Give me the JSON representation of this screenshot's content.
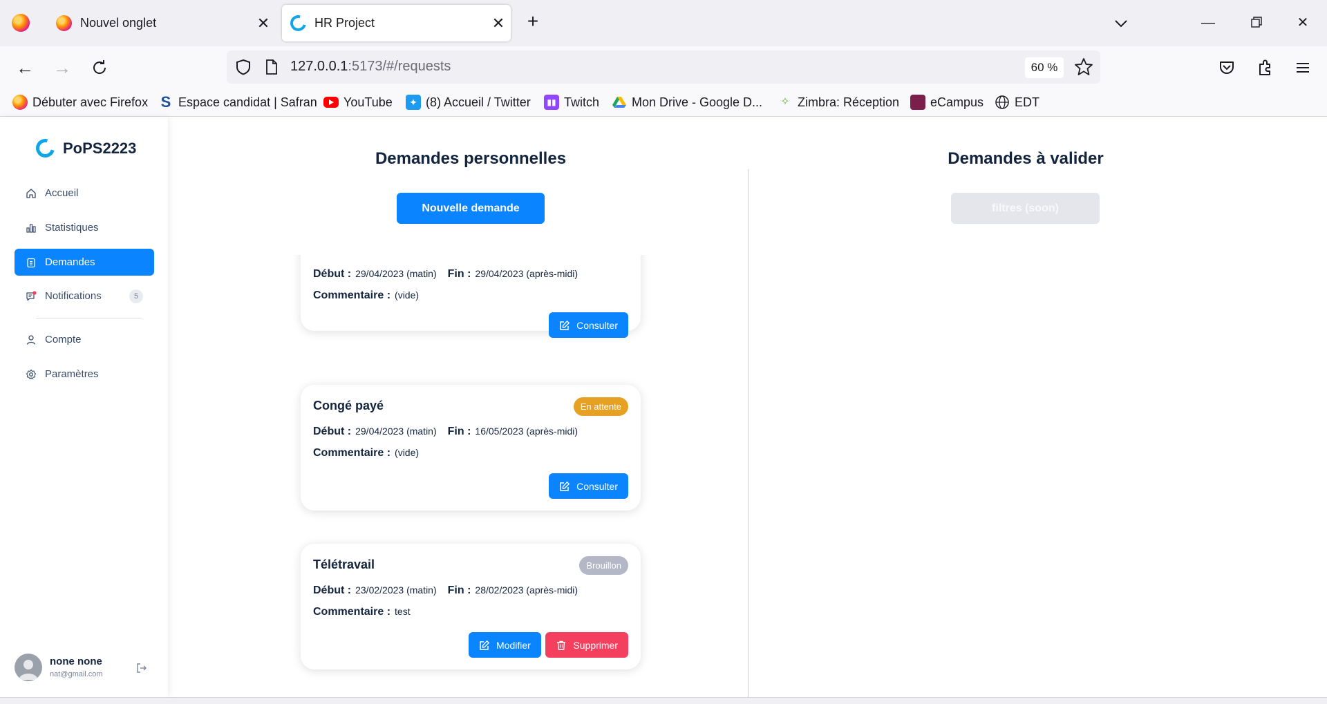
{
  "browser": {
    "tabs": [
      {
        "title": "Nouvel onglet",
        "active": false
      },
      {
        "title": "HR Project",
        "active": true
      }
    ],
    "url": {
      "host": "127.0.0.1",
      "rest": ":5173/#/requests"
    },
    "zoom": "60 %",
    "bookmarks": [
      {
        "label": "Débuter avec Firefox",
        "icon": "firefox-icon",
        "color": "#ff7139"
      },
      {
        "label": "Espace candidat | Safran",
        "icon": "safran-icon",
        "color": "#1f4fa0"
      },
      {
        "label": "YouTube",
        "icon": "youtube-icon",
        "color": "#ff0000"
      },
      {
        "label": "(8) Accueil / Twitter",
        "icon": "twitter-icon",
        "color": "#1d9bf0"
      },
      {
        "label": "Twitch",
        "icon": "twitch-icon",
        "color": "#9146ff"
      },
      {
        "label": "Mon Drive - Google D...",
        "icon": "google-drive-icon",
        "color": "#1fa463"
      },
      {
        "label": "Zimbra: Réception",
        "icon": "zimbra-icon",
        "color": "#6bb43f"
      },
      {
        "label": "eCampus",
        "icon": "ecampus-icon",
        "color": "#7a1f4b"
      },
      {
        "label": "EDT",
        "icon": "globe-icon",
        "color": "#1c1b22"
      }
    ]
  },
  "sidebar": {
    "brand": "PoPS2223",
    "items": [
      {
        "label": "Accueil",
        "icon": "home-icon"
      },
      {
        "label": "Statistiques",
        "icon": "stats-icon"
      },
      {
        "label": "Demandes",
        "icon": "clipboard-icon",
        "active": true
      },
      {
        "label": "Notifications",
        "icon": "notification-icon",
        "count": "5"
      },
      {
        "label": "Compte",
        "icon": "user-icon"
      },
      {
        "label": "Paramètres",
        "icon": "settings-icon"
      }
    ],
    "user": {
      "name": "none none",
      "email": "nat@gmail.com"
    }
  },
  "main": {
    "personal_title": "Demandes personnelles",
    "new_request_label": "Nouvelle demande",
    "validate_title": "Demandes à valider",
    "filters_label": "filtres (soon)",
    "labels": {
      "start": "Début :",
      "end": "Fin :",
      "comment": "Commentaire :"
    },
    "requests": [
      {
        "type": "",
        "status": "",
        "start": "29/04/2023 (matin)",
        "end": "29/04/2023 (après-midi)",
        "comment": "(vide)",
        "actions": [
          "Consulter"
        ]
      },
      {
        "type": "Congé payé",
        "status": "En attente",
        "start": "29/04/2023 (matin)",
        "end": "16/05/2023 (après-midi)",
        "comment": "(vide)",
        "actions": [
          "Consulter"
        ]
      },
      {
        "type": "Télétravail",
        "status": "Brouillon",
        "start": "23/02/2023 (matin)",
        "end": "28/02/2023 (après-midi)",
        "comment": "test",
        "actions": [
          "Modifier",
          "Supprimer"
        ]
      }
    ]
  },
  "colors": {
    "accent": "#0a84ff",
    "pending": "#e6a023",
    "draft": "#b3b7c6",
    "danger": "#f43f5e"
  }
}
